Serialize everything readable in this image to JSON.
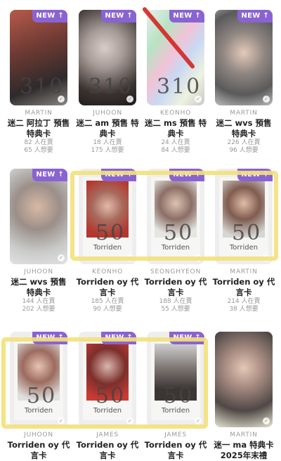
{
  "badge_label": "NEW ↑",
  "cards": [
    {
      "member": "MARTIN",
      "title": "迷二 阿拉丁 預售 特典卡",
      "sell": "82 人在賣",
      "want": "65 人想要",
      "note": "310"
    },
    {
      "member": "JUHOON",
      "title": "迷二 am 預售 特典卡",
      "sell": "18 人在賣",
      "want": "175 人想要",
      "note": "310"
    },
    {
      "member": "KEONHO",
      "title": "迷二 ms 預售 特典卡",
      "sell": "24 人在賣",
      "want": "84 人想要",
      "note": "310"
    },
    {
      "member": "MARTIN",
      "title": "迷二 wvs 預售 特典卡",
      "sell": "226 人在賣",
      "want": "96 人想要",
      "note": ""
    },
    {
      "member": "JUHOON",
      "title": "迷二 wvs 預售 特典卡",
      "sell": "144 人在賣",
      "want": "202 人想要",
      "note": ""
    },
    {
      "member": "KEONHO",
      "title": "Torriden oy 代言卡",
      "sell": "185 人在賣",
      "want": "90 人想要",
      "note": "50",
      "caption": "Torriden"
    },
    {
      "member": "SEONGHYEON",
      "title": "Torriden oy 代言卡",
      "sell": "188 人在賣",
      "want": "55 人想要",
      "note": "50",
      "caption": "Torriden"
    },
    {
      "member": "MARTIN",
      "title": "Torriden oy 代言卡",
      "sell": "214 人在賣",
      "want": "38 人想要",
      "note": "50",
      "caption": "Torriden"
    },
    {
      "member": "JUHOON",
      "title": "Torriden oy 代言卡",
      "sell": "",
      "want": "",
      "note": "50",
      "caption": "Torriden"
    },
    {
      "member": "JAMES",
      "title": "Torriden oy 代言卡",
      "sell": "",
      "want": "",
      "note": "50",
      "caption": "Torriden"
    },
    {
      "member": "JAMES",
      "title": "Torriden oy 代言卡",
      "sell": "",
      "want": "",
      "note": "50",
      "caption": "Torriden"
    },
    {
      "member": "MARTIN",
      "title": "迷一 ma 特典卡 2025年末禮",
      "sell": "",
      "want": "",
      "note": ""
    }
  ],
  "colors": {
    "badge": "#8a63d2",
    "highlight": "#f3e07a",
    "strike": "#d3261f"
  }
}
